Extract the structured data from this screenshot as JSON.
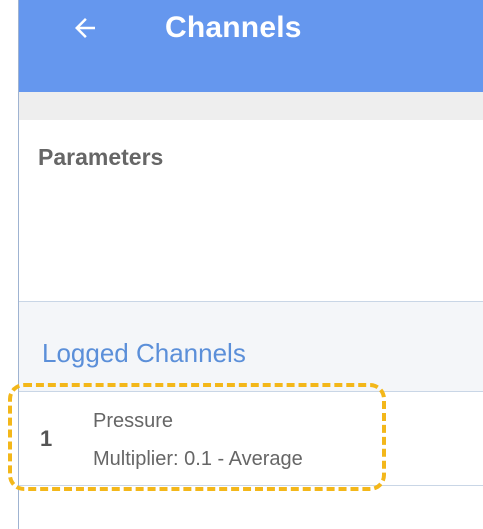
{
  "header": {
    "title": "Channels",
    "back_icon": "arrow-left-icon",
    "background_color": "#6597ee"
  },
  "parameters": {
    "heading": "Parameters"
  },
  "logged_channels": {
    "heading": "Logged Channels",
    "heading_color": "#5b8fd9",
    "items": [
      {
        "number": "1",
        "name": "Pressure",
        "detail": "Multiplier: 0.1 - Average"
      }
    ]
  },
  "highlight": {
    "color": "#f3b71a",
    "style": "dashed"
  }
}
